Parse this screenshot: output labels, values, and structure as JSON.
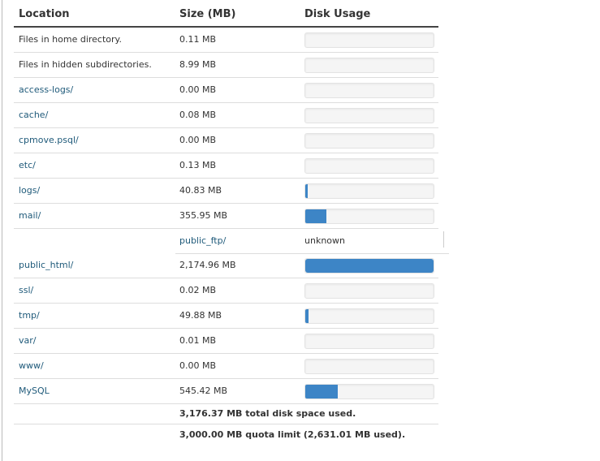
{
  "table": {
    "headers": {
      "location": "Location",
      "size": "Size (MB)",
      "usage": "Disk Usage"
    },
    "rows": [
      {
        "location": "Files in home directory.",
        "size": "0.11 MB",
        "usage_fraction": 0.0
      },
      {
        "location": "Files in hidden subdirectories.",
        "size": "8.99 MB",
        "usage_fraction": 0.0
      },
      {
        "location": "access-logs/",
        "size": "0.00 MB",
        "usage_fraction": 0.0
      },
      {
        "location": "cache/",
        "size": "0.08 MB",
        "usage_fraction": 0.0
      },
      {
        "location": "cpmove.psql/",
        "size": "0.00 MB",
        "usage_fraction": 0.0
      },
      {
        "location": "etc/",
        "size": "0.13 MB",
        "usage_fraction": 0.0
      },
      {
        "location": "logs/",
        "size": "40.83 MB",
        "usage_fraction": 0.019
      },
      {
        "location": "mail/",
        "size": "355.95 MB",
        "usage_fraction": 0.164
      },
      {
        "location": "public_ftp/",
        "usage_text": "unknown"
      },
      {
        "location": "public_html/",
        "size": "2,174.96 MB",
        "usage_fraction": 1.0
      },
      {
        "location": "ssl/",
        "size": "0.02 MB",
        "usage_fraction": 0.0
      },
      {
        "location": "tmp/",
        "size": "49.88 MB",
        "usage_fraction": 0.023
      },
      {
        "location": "var/",
        "size": "0.01 MB",
        "usage_fraction": 0.0
      },
      {
        "location": "www/",
        "size": "0.00 MB",
        "usage_fraction": 0.0
      },
      {
        "location": "MySQL",
        "size": "545.42 MB",
        "usage_fraction": 0.251
      }
    ],
    "total": "3,176.37 MB total disk space used.",
    "quota": "3,000.00 MB quota limit (2,631.01 MB used)."
  },
  "colors": {
    "bar_fill": "#3d85c6",
    "bar_track": "#f5f5f5",
    "link": "#1f5a7a"
  }
}
